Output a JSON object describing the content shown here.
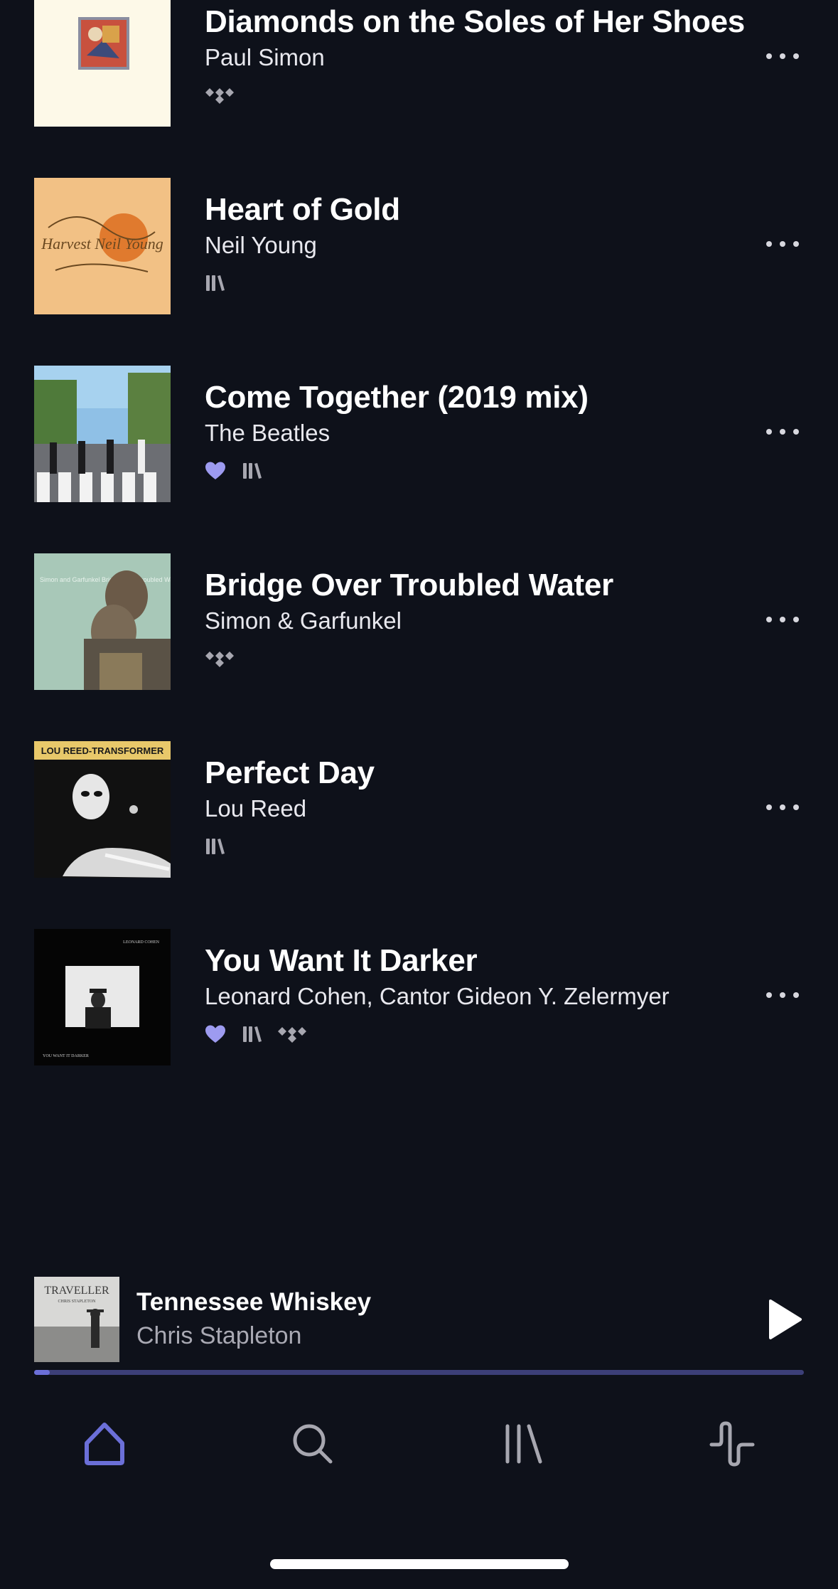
{
  "tracks": [
    {
      "title": "Diamonds on the Soles of Her Shoes",
      "artist": "Paul Simon",
      "badges": [
        "tidal"
      ]
    },
    {
      "title": "Heart of Gold",
      "artist": "Neil Young",
      "badges": [
        "library"
      ]
    },
    {
      "title": "Come Together (2019 mix)",
      "artist": "The Beatles",
      "badges": [
        "favorite",
        "library"
      ]
    },
    {
      "title": "Bridge Over Troubled Water",
      "artist": "Simon & Garfunkel",
      "badges": [
        "tidal"
      ]
    },
    {
      "title": "Perfect Day",
      "artist": "Lou Reed",
      "badges": [
        "library"
      ]
    },
    {
      "title": "You Want It Darker",
      "artist": "Leonard Cohen, Cantor Gideon Y. Zelermyer",
      "badges": [
        "favorite",
        "library",
        "tidal"
      ]
    }
  ],
  "album_art_text": {
    "harvest": "Harvest Neil Young",
    "bridge": "Simon and Garfunkel Bridge Over Troubled Water",
    "transformer": "LOU REED-TRANSFORMER",
    "darker_top": "LEONARD COHEN",
    "darker_bottom": "YOU WANT IT DARKER",
    "traveller_top": "TRAVELLER",
    "traveller_mid": "CHRIS STAPLETON"
  },
  "now_playing": {
    "title": "Tennessee Whiskey",
    "artist": "Chris Stapleton",
    "progress": 0.02
  },
  "tabs": [
    {
      "name": "home",
      "icon": "home-icon",
      "active": true
    },
    {
      "name": "search",
      "icon": "search-icon",
      "active": false
    },
    {
      "name": "library",
      "icon": "library-icon",
      "active": false
    },
    {
      "name": "activity",
      "icon": "waveform-icon",
      "active": false
    }
  ],
  "colors": {
    "background": "#0e111a",
    "accent": "#6b6fd8",
    "heart": "#9d9bf0",
    "badge_gray": "#a7a7b0"
  }
}
